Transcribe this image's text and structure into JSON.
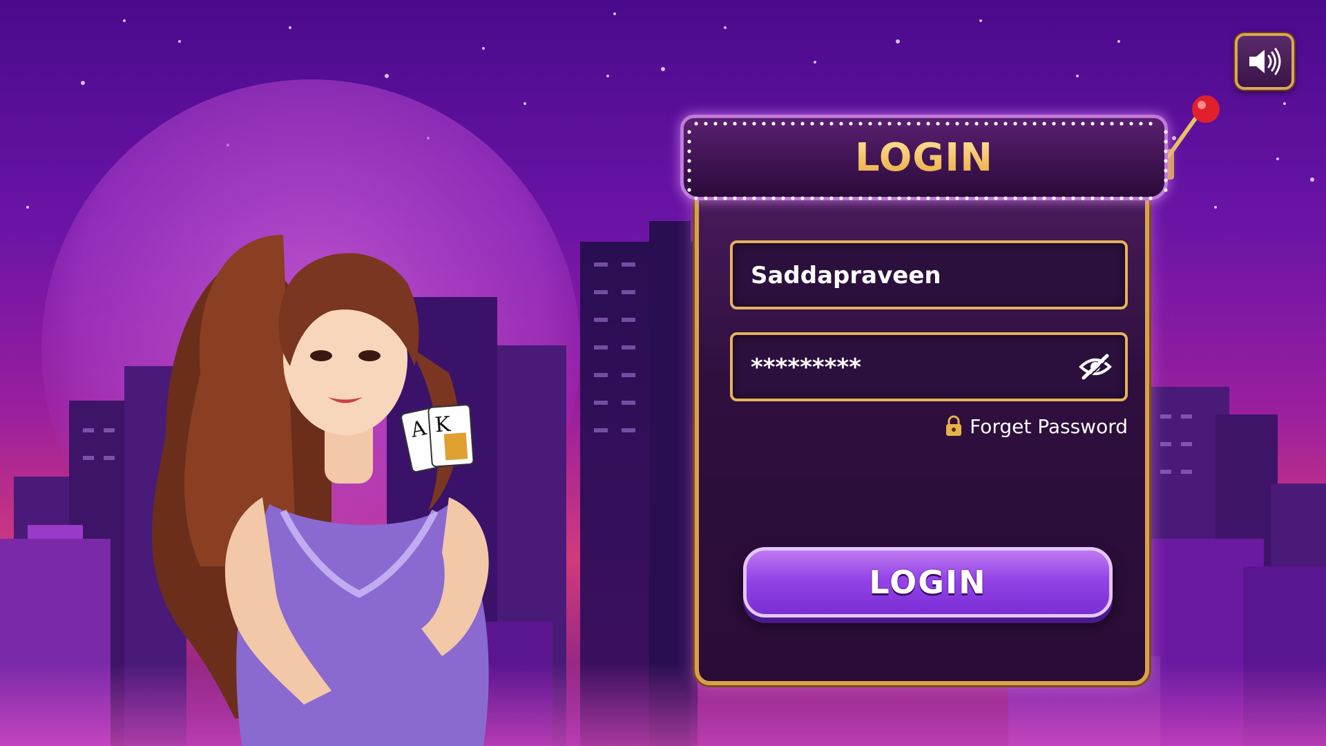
{
  "sound": {
    "icon": "speaker-icon"
  },
  "panel": {
    "title": "LOGIN"
  },
  "login_form": {
    "username_value": "Saddapraveen",
    "password_value": "*********",
    "eye_icon": "eye-slash-icon",
    "forgot_label": "Forget Password",
    "forgot_icon": "lock-icon",
    "submit_label": "LOGIN"
  },
  "colors": {
    "accent_gold": "#e6b25c",
    "button_purple": "#9444e8",
    "panel_dark": "#2b0f3c"
  }
}
